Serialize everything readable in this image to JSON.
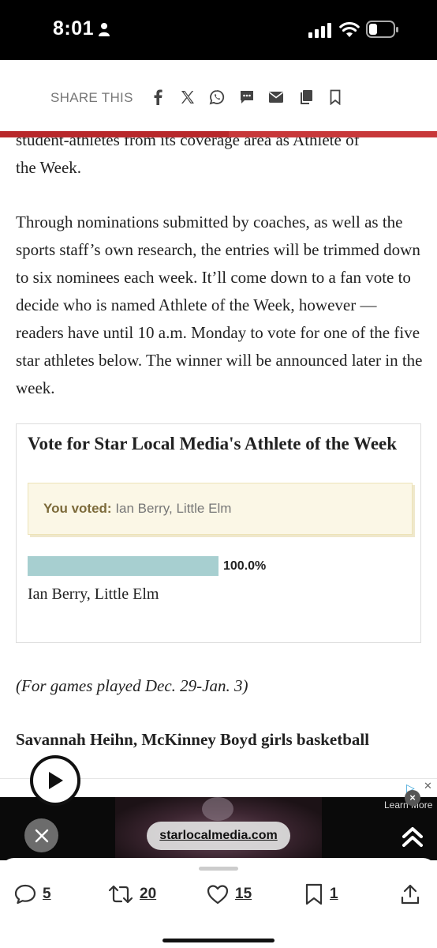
{
  "status_bar": {
    "time": "8:01"
  },
  "share_bar": {
    "label": "SHARE THIS",
    "icons": [
      "facebook-icon",
      "x-icon",
      "whatsapp-icon",
      "sms-icon",
      "email-icon",
      "copy-icon",
      "bookmark-icon"
    ]
  },
  "colors": {
    "accent_red": "#c8383a",
    "poll_bar": "#a7cfd0",
    "voted_box": "#fbf7e6"
  },
  "article": {
    "para_1_line_1": "student-athletes from its coverage area as Athlete of",
    "para_1_line_2": "the Week.",
    "para_2": "Through nominations submitted by coaches, as well as the sports staff’s own research, the entries will be trimmed down to six nominees each week. It’ll come down to a fan vote to decide who is named Athlete of the Week, however — readers have until 10 a.m. Monday to vote for one of the five star athletes below. The winner will be announced later in the week.",
    "games_note": "(For games played Dec. 29-Jan. 3)",
    "athlete_heading": "Savannah Heihn, McKinney Boyd girls basketball"
  },
  "poll": {
    "title": "Vote for Star Local Media's Athlete of the Week",
    "voted_label": "You voted:",
    "voted_value": "Ian Berry, Little Elm",
    "results": [
      {
        "name": "Ian Berry, Little Elm",
        "percent_label": "100.0%",
        "fraction": 1.0
      }
    ]
  },
  "ad": {
    "url_label": "starlocalmedia.com",
    "learn_more": "Learn More"
  },
  "actions": {
    "replies": "5",
    "reposts": "20",
    "likes": "15",
    "bookmarks": "1"
  }
}
